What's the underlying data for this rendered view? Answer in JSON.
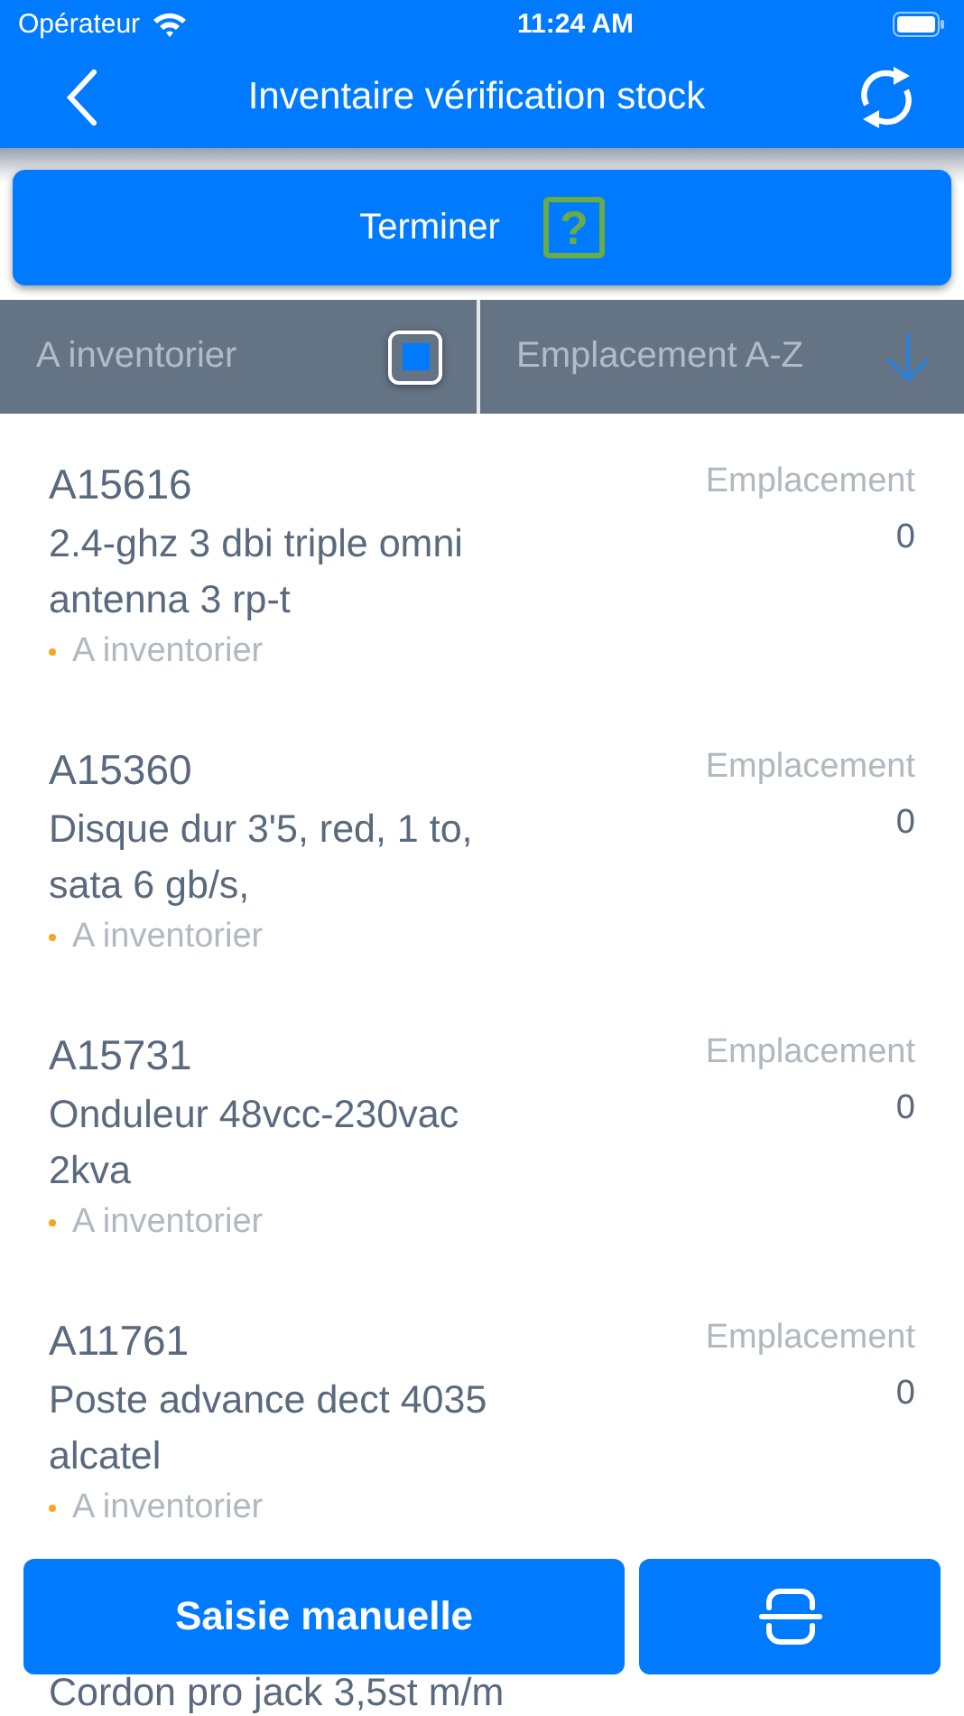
{
  "status_bar": {
    "carrier": "Opérateur",
    "time": "11:24 AM"
  },
  "nav": {
    "title": "Inventaire vérification stock"
  },
  "finish_button": {
    "label": "Terminer",
    "help": "?"
  },
  "filter": {
    "label": "A inventorier",
    "checked": true
  },
  "sort": {
    "label": "Emplacement A-Z"
  },
  "items": [
    {
      "code": "A15616",
      "description": "2.4-ghz 3 dbi triple omni antenna 3 rp-t",
      "status": "A inventorier",
      "location_label": "Emplacement",
      "quantity": "0"
    },
    {
      "code": "A15360",
      "description": "Disque dur 3'5, red, 1 to, sata 6 gb/s,",
      "status": "A inventorier",
      "location_label": "Emplacement",
      "quantity": "0"
    },
    {
      "code": "A15731",
      "description": "Onduleur 48vcc-230vac 2kva",
      "status": "A inventorier",
      "location_label": "Emplacement",
      "quantity": "0"
    },
    {
      "code": "A11761",
      "description": "Poste advance dect 4035 alcatel",
      "status": "A inventorier",
      "location_label": "Emplacement",
      "quantity": "0"
    },
    {
      "description": "Cordon pro jack 3,5st m/m"
    }
  ],
  "manual_button": {
    "label": "Saisie manuelle"
  }
}
